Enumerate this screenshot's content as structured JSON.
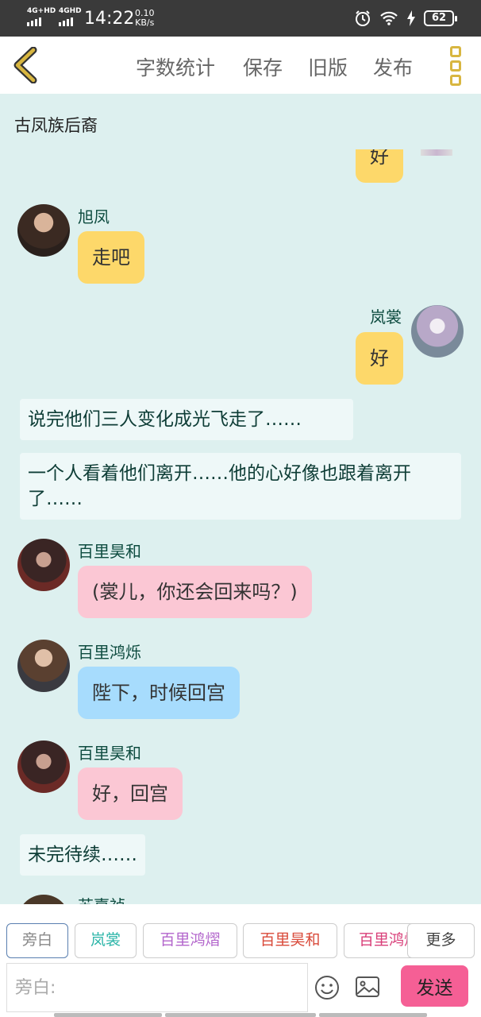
{
  "status": {
    "net1": "4G+HD",
    "net2": "4GHD",
    "time": "14:22",
    "speed_value": "0.10",
    "speed_unit": "KB/s",
    "battery": "62"
  },
  "nav": {
    "word_count": "字数统计",
    "save": "保存",
    "old_version": "旧版",
    "publish": "发布"
  },
  "chat_title": "古凤族后裔",
  "messages": {
    "m0_text": "好",
    "m1_sender": "旭凤",
    "m1_text": "走吧",
    "m2_sender": "岚裳",
    "m2_text": "好",
    "n1": "说完他们三人变化成光飞走了……",
    "n2": "一个人看着他们离开……他的心好像也跟着离开了……",
    "m3_sender": "百里昊和",
    "m3_text": "(裳儿，你还会回来吗？)",
    "m4_sender": "百里鸿烁",
    "m4_text": "陛下，时候回宫",
    "m5_sender": "百里昊和",
    "m5_text": "好，回宫",
    "n3": "未完待续……",
    "m6_sender": "苏嘉祯"
  },
  "roles": [
    {
      "label": "旁白",
      "color": "#888888"
    },
    {
      "label": "岚裳",
      "color": "#2bb5a8"
    },
    {
      "label": "百里鸿熠",
      "color": "#b366cc"
    },
    {
      "label": "百里昊和",
      "color": "#d94a3a"
    },
    {
      "label": "百里鸿烁",
      "color": "#d9407a"
    },
    {
      "label": "更多",
      "color": "#444444"
    }
  ],
  "composer": {
    "placeholder": "旁白:",
    "send": "发送"
  },
  "icons": {
    "back": "chevron-left-icon",
    "menu": "more-icon",
    "emoji": "emoji-icon",
    "image": "image-icon"
  },
  "colors": {
    "accent": "#f55f95",
    "nav_icon": "#d8b640",
    "chat_bg": "#ddf0ef"
  }
}
